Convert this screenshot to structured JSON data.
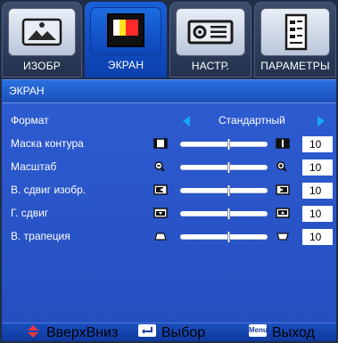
{
  "tabs": [
    {
      "label": "ИЗОБР",
      "icon": "picture-icon",
      "active": false
    },
    {
      "label": "ЭКРАН",
      "icon": "display-color-bars-icon",
      "active": true
    },
    {
      "label": "НАСТР.",
      "icon": "projector-setup-icon",
      "active": false
    },
    {
      "label": "ПАРАМЕТРЫ",
      "icon": "options-document-icon",
      "active": false
    }
  ],
  "section": {
    "title": "ЭКРАН"
  },
  "rows": [
    {
      "label": "Формат",
      "type": "selector",
      "value": "Стандартный"
    },
    {
      "label": "Маска контура",
      "type": "slider",
      "left_icon": "mask-decrease-icon",
      "right_icon": "mask-increase-icon",
      "value": "10",
      "level": 0.55
    },
    {
      "label": "Масштаб",
      "type": "slider",
      "left_icon": "zoom-out-icon",
      "right_icon": "zoom-in-icon",
      "value": "10",
      "level": 0.55
    },
    {
      "label": "В. сдвиг изобр.",
      "type": "slider",
      "left_icon": "h-shift-left-icon",
      "right_icon": "h-shift-right-icon",
      "value": "10",
      "level": 0.55
    },
    {
      "label": "Г. сдвиг",
      "type": "slider",
      "left_icon": "v-shift-down-icon",
      "right_icon": "v-shift-up-icon",
      "value": "10",
      "level": 0.55
    },
    {
      "label": "В. трапеция",
      "type": "slider",
      "left_icon": "keystone-top-icon",
      "right_icon": "keystone-bottom-icon",
      "value": "10",
      "level": 0.55
    }
  ],
  "footer": {
    "updown_label": "ВверхВниз",
    "select_label": "Выбор",
    "menu_icon_text": "Menu",
    "exit_label": "Выход"
  },
  "colors": {
    "tab_active": "#1a60d8",
    "content_bg": "#2d5bd0",
    "arrow": "#19a6ff",
    "updown_icon": "#e8373c"
  }
}
